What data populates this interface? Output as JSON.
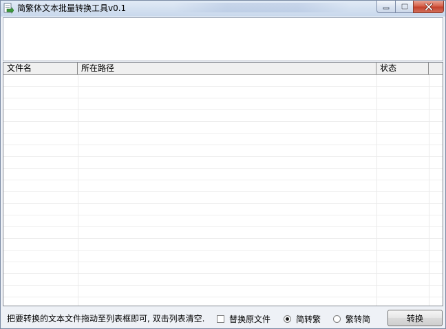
{
  "window": {
    "title": "简繁体文本批量转换工具v0.1"
  },
  "list": {
    "columns": [
      {
        "label": "文件名"
      },
      {
        "label": "所在路径"
      },
      {
        "label": "状态"
      },
      {
        "label": ""
      }
    ]
  },
  "bottom": {
    "hint": "把要转换的文本文件拖动至列表框即可, 双击列表清空.",
    "replace_original_label": "替换原文件",
    "replace_original_checked": false,
    "mode_options": [
      {
        "label": "简转繁",
        "checked": true
      },
      {
        "label": "繁转简",
        "checked": false
      }
    ],
    "convert_label": "转换"
  },
  "icons": {
    "app": "app-icon",
    "minimize": "minimize-icon",
    "maximize": "maximize-icon",
    "close": "close-icon"
  },
  "colors": {
    "close_button": "#c4412b",
    "title_bar": "#d3e0f0"
  }
}
